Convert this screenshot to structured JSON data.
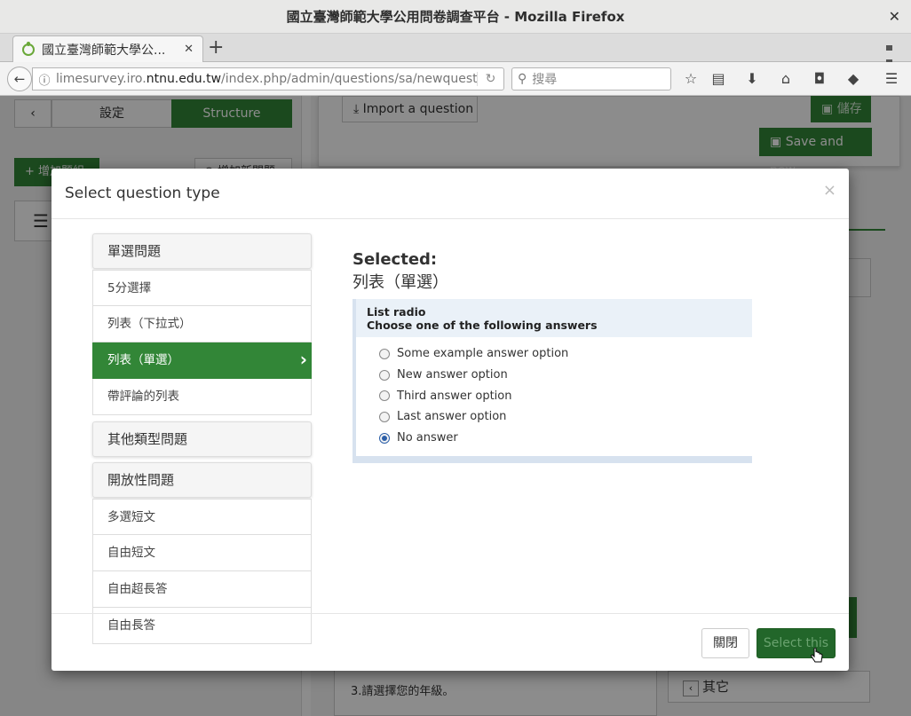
{
  "browser": {
    "window_title": "國立臺灣師範大學公用問卷調查平台 - Mozilla Firefox",
    "tab_title": "國立臺灣師範大學公...",
    "url_prefix": "limesurvey.iro.",
    "url_domain": "ntnu.edu.tw",
    "url_path": "/index.php/admin/questions/sa/newquestic",
    "search_placeholder": "搜尋"
  },
  "background": {
    "settings_tab": "設定",
    "structure_tab": "Structure",
    "add_group": "增加題組",
    "add_question": "增加新問題",
    "import_question": "Import a question",
    "save": "儲存",
    "save_and_new": "Save and new",
    "question_text": "3.請選擇您的年級。",
    "other_label": "其它"
  },
  "modal": {
    "title": "Select question type",
    "close_x": "×",
    "groups": [
      {
        "label": "單選問題",
        "items": [
          "5分選擇",
          "列表（下拉式）",
          "列表（單選）",
          "帶評論的列表"
        ]
      },
      {
        "label": "其他類型問題",
        "items": []
      },
      {
        "label": "開放性問題",
        "items": [
          "多選短文",
          "自由短文",
          "自由超長答",
          "自由長答"
        ]
      }
    ],
    "selected_label": "Selected:",
    "selected_value": "列表（單選）",
    "preview": {
      "type_name": "List radio",
      "question": "Choose one of the following answers",
      "options": [
        "Some example answer option",
        "New answer option",
        "Third answer option",
        "Last answer option",
        "No answer"
      ],
      "checked_index": 4
    },
    "close_button": "關閉",
    "select_button": "Select this"
  },
  "colors": {
    "primary_green": "#328637",
    "preview_border": "#d7e2ef"
  }
}
